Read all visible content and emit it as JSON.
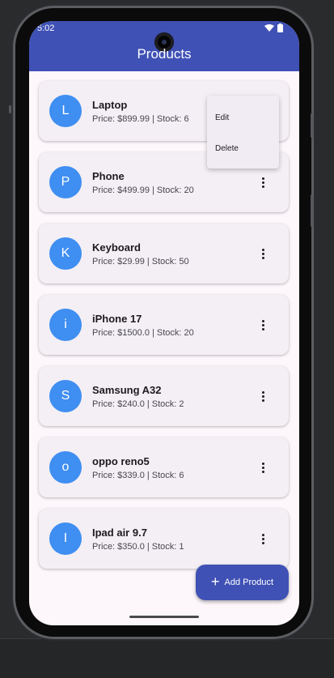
{
  "status_bar": {
    "time": "5:02"
  },
  "app_bar": {
    "title": "Products"
  },
  "products": [
    {
      "initial": "L",
      "name": "Laptop",
      "details": "Price: $899.99 | Stock: 6"
    },
    {
      "initial": "P",
      "name": "Phone",
      "details": "Price: $499.99 | Stock: 20"
    },
    {
      "initial": "K",
      "name": "Keyboard",
      "details": "Price: $29.99 | Stock: 50"
    },
    {
      "initial": "i",
      "name": "iPhone 17",
      "details": "Price: $1500.0 | Stock: 20"
    },
    {
      "initial": "S",
      "name": "Samsung A32",
      "details": "Price: $240.0 | Stock: 2"
    },
    {
      "initial": "o",
      "name": "oppo reno5",
      "details": "Price: $339.0 | Stock: 6"
    },
    {
      "initial": "I",
      "name": "Ipad air 9.7",
      "details": "Price: $350.0 | Stock: 1"
    }
  ],
  "popup_menu": {
    "edit": "Edit",
    "delete": "Delete"
  },
  "fab": {
    "label": "Add Product",
    "icon": "plus-icon"
  },
  "colors": {
    "primary": "#3f51b5",
    "avatar": "#3f8ef1",
    "card": "#f3eff5",
    "background": "#fdf7fb"
  }
}
